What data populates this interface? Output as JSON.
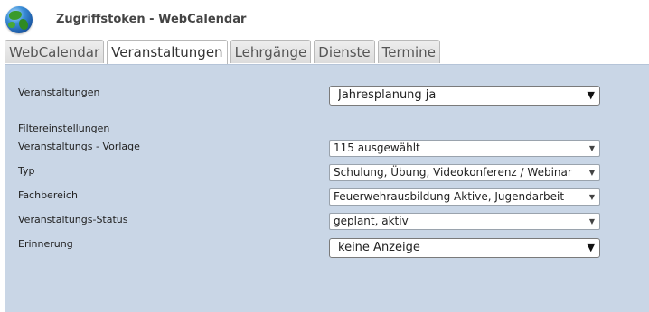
{
  "header": {
    "title": "Zugriffstoken - WebCalendar"
  },
  "tabs": [
    {
      "label": "WebCalendar"
    },
    {
      "label": "Veranstaltungen"
    },
    {
      "label": "Lehrgänge"
    },
    {
      "label": "Dienste"
    },
    {
      "label": "Termine"
    }
  ],
  "form": {
    "veranstaltungen": {
      "label": "Veranstaltungen",
      "value": "Jahresplanung ja"
    },
    "filter_heading": "Filtereinstellungen",
    "vorlage": {
      "label": "Veranstaltungs - Vorlage",
      "value": "115 ausgewählt"
    },
    "typ": {
      "label": "Typ",
      "value": "Schulung, Übung, Videokonferenz / Webinar"
    },
    "fachbereich": {
      "label": "Fachbereich",
      "value": "Feuerwehrausbildung Aktive, Jugendarbeit"
    },
    "status": {
      "label": "Veranstaltungs-Status",
      "value": "geplant, aktiv"
    },
    "erinnerung": {
      "label": "Erinnerung",
      "value": "keine Anzeige"
    }
  },
  "icons": {
    "logo": "globe-icon",
    "dropdown": "chevron-down-icon"
  },
  "colors": {
    "panel_background": "#c9d6e6",
    "tab_background": "#dcdcdc",
    "active_tab_background": "#ffffff"
  }
}
